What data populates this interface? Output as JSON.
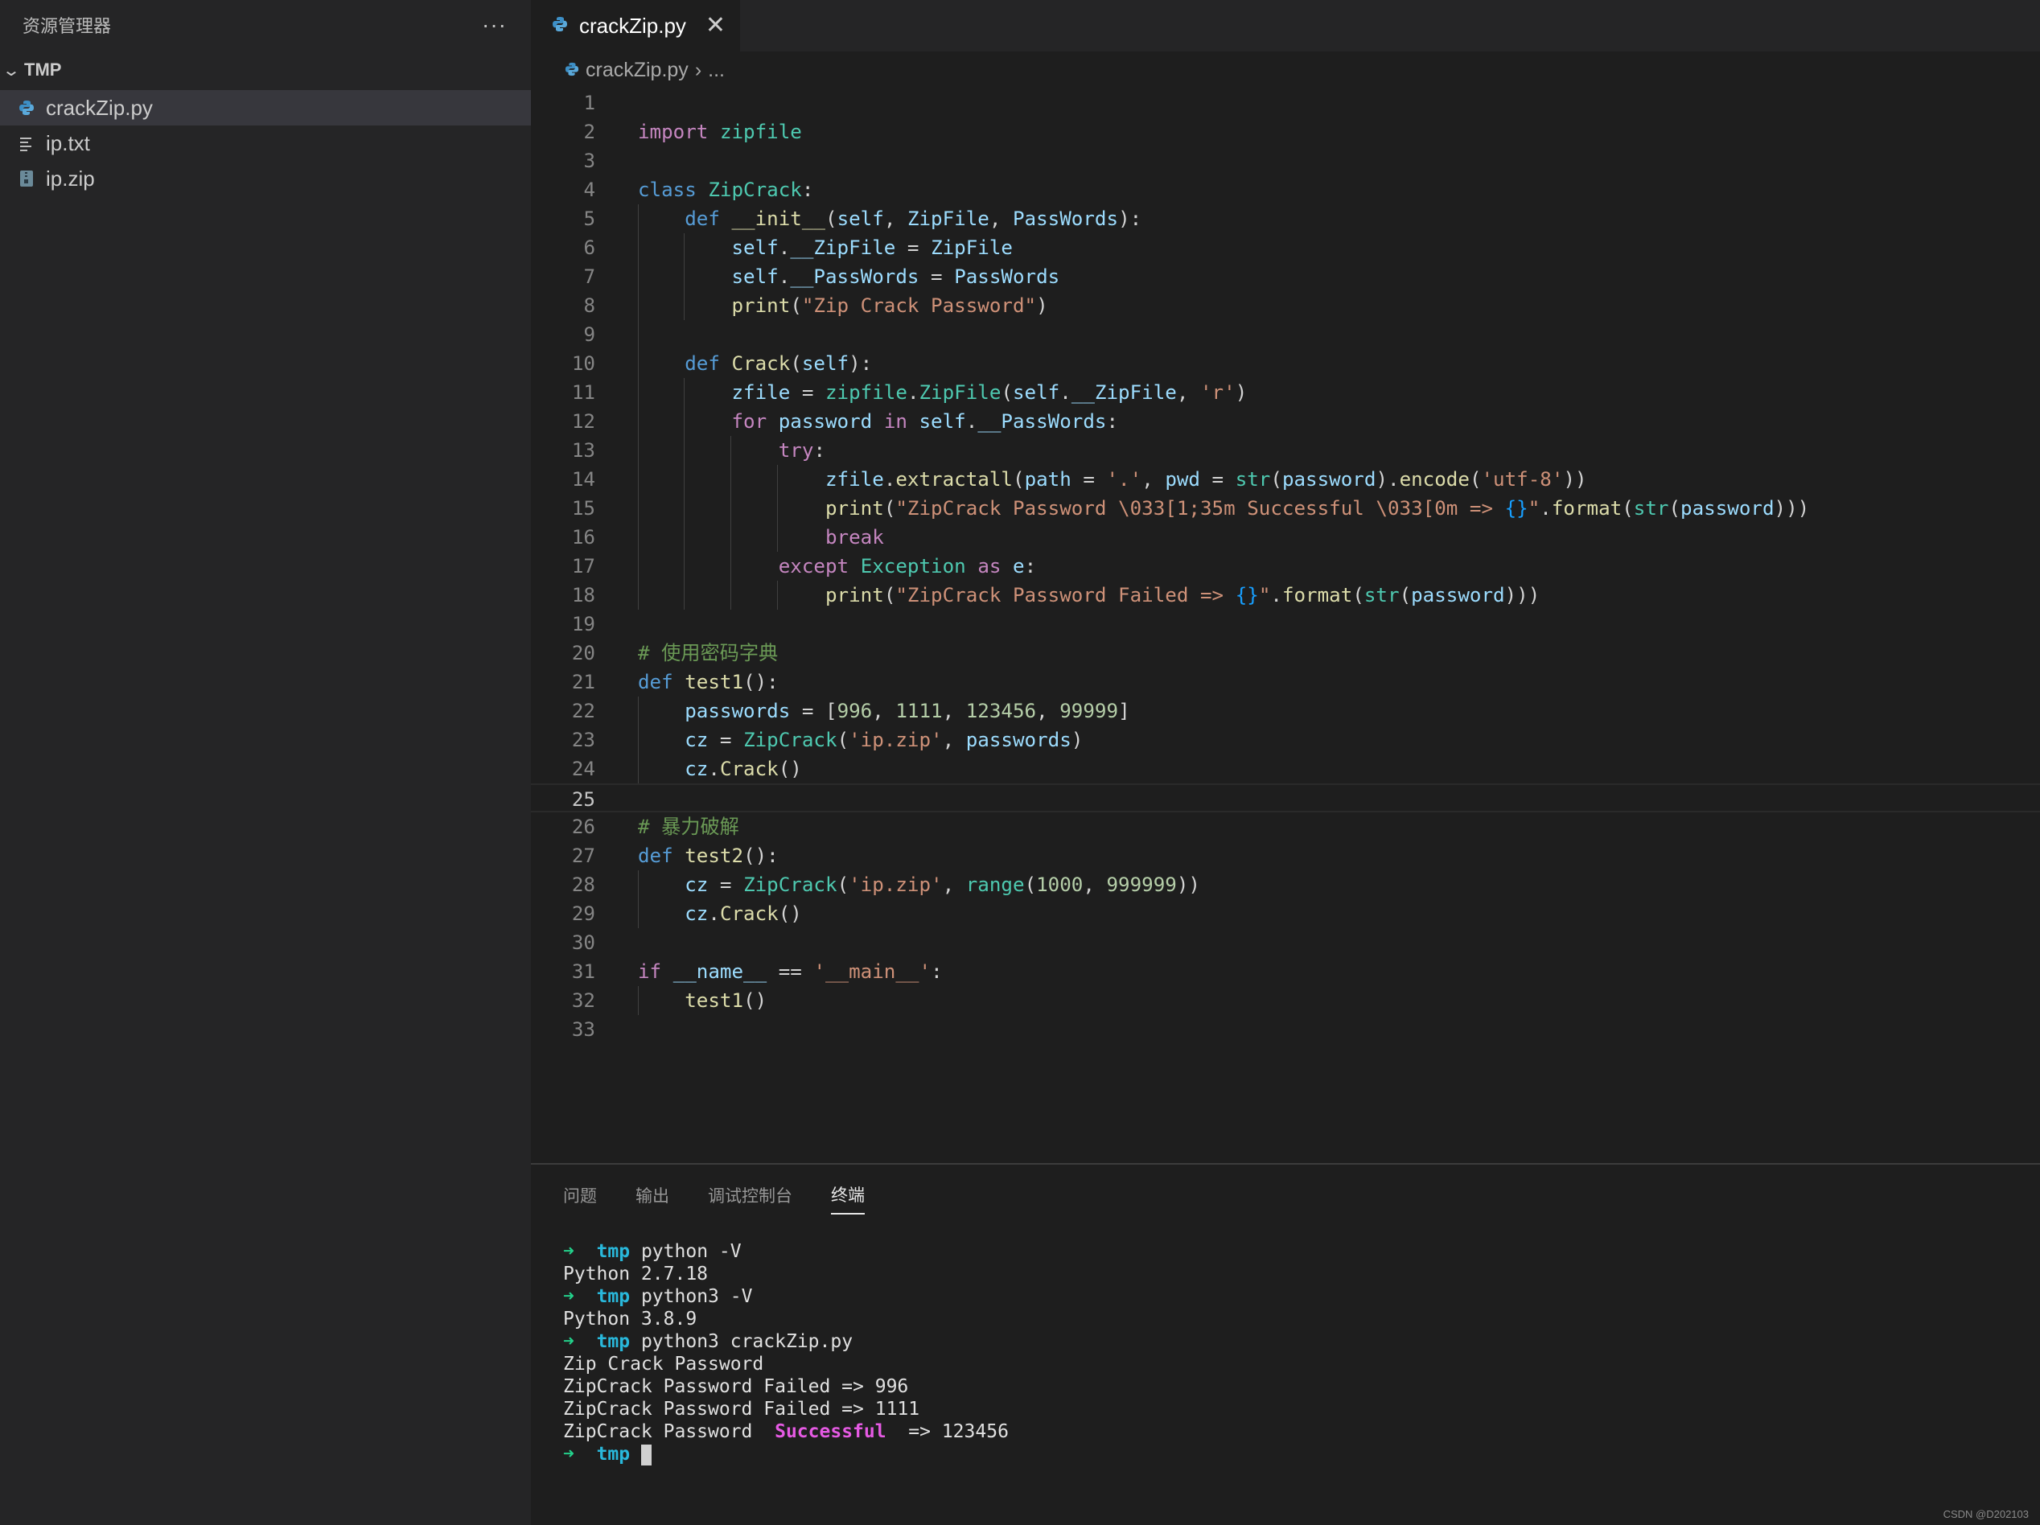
{
  "sidebar": {
    "title": "资源管理器",
    "more": "···",
    "folder": "TMP",
    "files": [
      {
        "label": "crackZip.py",
        "icon": "python-file-icon",
        "active": true
      },
      {
        "label": "ip.txt",
        "icon": "text-file-icon",
        "active": false
      },
      {
        "label": "ip.zip",
        "icon": "zip-file-icon",
        "active": false
      }
    ]
  },
  "editor": {
    "tab_label": "crackZip.py",
    "close_glyph": "✕",
    "breadcrumb_file": "crackZip.py",
    "breadcrumb_sep": "›",
    "breadcrumb_more": "...",
    "current_line": 25,
    "lines": [
      {
        "n": "1",
        "indent": 0,
        "t": []
      },
      {
        "n": "2",
        "indent": 0,
        "t": [
          [
            "import",
            "kw2"
          ],
          [
            " ",
            "pl"
          ],
          [
            "zipfile",
            "cls"
          ]
        ]
      },
      {
        "n": "3",
        "indent": 0,
        "t": []
      },
      {
        "n": "4",
        "indent": 0,
        "t": [
          [
            "class",
            "kw"
          ],
          [
            " ",
            "pl"
          ],
          [
            "ZipCrack",
            "cls"
          ],
          [
            ":",
            "pl"
          ]
        ]
      },
      {
        "n": "5",
        "indent": 1,
        "t": [
          [
            "    ",
            "pl"
          ],
          [
            "def",
            "kw"
          ],
          [
            " ",
            "pl"
          ],
          [
            "__init__",
            "fn"
          ],
          [
            "(",
            "pl"
          ],
          [
            "self",
            "var"
          ],
          [
            ", ",
            "pl"
          ],
          [
            "ZipFile",
            "var"
          ],
          [
            ", ",
            "pl"
          ],
          [
            "PassWords",
            "var"
          ],
          [
            "):",
            "pl"
          ]
        ]
      },
      {
        "n": "6",
        "indent": 2,
        "t": [
          [
            "        ",
            "pl"
          ],
          [
            "self",
            "var"
          ],
          [
            ".",
            "pl"
          ],
          [
            "__ZipFile",
            "var"
          ],
          [
            " = ",
            "pl"
          ],
          [
            "ZipFile",
            "var"
          ]
        ]
      },
      {
        "n": "7",
        "indent": 2,
        "t": [
          [
            "        ",
            "pl"
          ],
          [
            "self",
            "var"
          ],
          [
            ".",
            "pl"
          ],
          [
            "__PassWords",
            "var"
          ],
          [
            " = ",
            "pl"
          ],
          [
            "PassWords",
            "var"
          ]
        ]
      },
      {
        "n": "8",
        "indent": 2,
        "t": [
          [
            "        ",
            "pl"
          ],
          [
            "print",
            "fn"
          ],
          [
            "(",
            "pl"
          ],
          [
            "\"Zip Crack Password\"",
            "str"
          ],
          [
            ")",
            "pl"
          ]
        ]
      },
      {
        "n": "9",
        "indent": 1,
        "t": []
      },
      {
        "n": "10",
        "indent": 1,
        "t": [
          [
            "    ",
            "pl"
          ],
          [
            "def",
            "kw"
          ],
          [
            " ",
            "pl"
          ],
          [
            "Crack",
            "fn"
          ],
          [
            "(",
            "pl"
          ],
          [
            "self",
            "var"
          ],
          [
            "):",
            "pl"
          ]
        ]
      },
      {
        "n": "11",
        "indent": 2,
        "t": [
          [
            "        ",
            "pl"
          ],
          [
            "zfile",
            "var"
          ],
          [
            " = ",
            "pl"
          ],
          [
            "zipfile",
            "cls"
          ],
          [
            ".",
            "pl"
          ],
          [
            "ZipFile",
            "cls"
          ],
          [
            "(",
            "pl"
          ],
          [
            "self",
            "var"
          ],
          [
            ".",
            "pl"
          ],
          [
            "__ZipFile",
            "var"
          ],
          [
            ", ",
            "pl"
          ],
          [
            "'r'",
            "str"
          ],
          [
            ")",
            "pl"
          ]
        ]
      },
      {
        "n": "12",
        "indent": 2,
        "t": [
          [
            "        ",
            "pl"
          ],
          [
            "for",
            "kw2"
          ],
          [
            " ",
            "pl"
          ],
          [
            "password",
            "var"
          ],
          [
            " ",
            "pl"
          ],
          [
            "in",
            "kw2"
          ],
          [
            " ",
            "pl"
          ],
          [
            "self",
            "var"
          ],
          [
            ".",
            "pl"
          ],
          [
            "__PassWords",
            "var"
          ],
          [
            ":",
            "pl"
          ]
        ]
      },
      {
        "n": "13",
        "indent": 3,
        "t": [
          [
            "            ",
            "pl"
          ],
          [
            "try",
            "kw2"
          ],
          [
            ":",
            "pl"
          ]
        ]
      },
      {
        "n": "14",
        "indent": 4,
        "t": [
          [
            "                ",
            "pl"
          ],
          [
            "zfile",
            "var"
          ],
          [
            ".",
            "pl"
          ],
          [
            "extractall",
            "fn"
          ],
          [
            "(",
            "pl"
          ],
          [
            "path",
            "var"
          ],
          [
            " = ",
            "pl"
          ],
          [
            "'.'",
            "str"
          ],
          [
            ", ",
            "pl"
          ],
          [
            "pwd",
            "var"
          ],
          [
            " = ",
            "pl"
          ],
          [
            "str",
            "cls"
          ],
          [
            "(",
            "pl"
          ],
          [
            "password",
            "var"
          ],
          [
            ").",
            "pl"
          ],
          [
            "encode",
            "fn"
          ],
          [
            "(",
            "pl"
          ],
          [
            "'utf-8'",
            "str"
          ],
          [
            "))",
            "pl"
          ]
        ]
      },
      {
        "n": "15",
        "indent": 4,
        "t": [
          [
            "                ",
            "pl"
          ],
          [
            "print",
            "fn"
          ],
          [
            "(",
            "pl"
          ],
          [
            "\"ZipCrack Password \\033[1;35m Successful \\033[0m => ",
            "str"
          ],
          [
            "{}",
            "br"
          ],
          [
            "\"",
            "str"
          ],
          [
            ".",
            "pl"
          ],
          [
            "format",
            "fn"
          ],
          [
            "(",
            "pl"
          ],
          [
            "str",
            "cls"
          ],
          [
            "(",
            "pl"
          ],
          [
            "password",
            "var"
          ],
          [
            "))",
            "pl"
          ],
          [
            ")",
            "pl"
          ]
        ]
      },
      {
        "n": "16",
        "indent": 4,
        "t": [
          [
            "                ",
            "pl"
          ],
          [
            "break",
            "kw2"
          ]
        ]
      },
      {
        "n": "17",
        "indent": 3,
        "t": [
          [
            "            ",
            "pl"
          ],
          [
            "except",
            "kw2"
          ],
          [
            " ",
            "pl"
          ],
          [
            "Exception",
            "cls"
          ],
          [
            " ",
            "pl"
          ],
          [
            "as",
            "kw2"
          ],
          [
            " ",
            "pl"
          ],
          [
            "e",
            "var"
          ],
          [
            ":",
            "pl"
          ]
        ]
      },
      {
        "n": "18",
        "indent": 4,
        "t": [
          [
            "                ",
            "pl"
          ],
          [
            "print",
            "fn"
          ],
          [
            "(",
            "pl"
          ],
          [
            "\"ZipCrack Password Failed => ",
            "str"
          ],
          [
            "{}",
            "br"
          ],
          [
            "\"",
            "str"
          ],
          [
            ".",
            "pl"
          ],
          [
            "format",
            "fn"
          ],
          [
            "(",
            "pl"
          ],
          [
            "str",
            "cls"
          ],
          [
            "(",
            "pl"
          ],
          [
            "password",
            "var"
          ],
          [
            ")))",
            "pl"
          ]
        ]
      },
      {
        "n": "19",
        "indent": 0,
        "t": []
      },
      {
        "n": "20",
        "indent": 0,
        "t": [
          [
            "# 使用密码字典",
            "cm"
          ]
        ]
      },
      {
        "n": "21",
        "indent": 0,
        "t": [
          [
            "def",
            "kw"
          ],
          [
            " ",
            "pl"
          ],
          [
            "test1",
            "fn"
          ],
          [
            "():",
            "pl"
          ]
        ]
      },
      {
        "n": "22",
        "indent": 1,
        "t": [
          [
            "    ",
            "pl"
          ],
          [
            "passwords",
            "var"
          ],
          [
            " = [",
            "pl"
          ],
          [
            "996",
            "num"
          ],
          [
            ", ",
            "pl"
          ],
          [
            "1111",
            "num"
          ],
          [
            ", ",
            "pl"
          ],
          [
            "123456",
            "num"
          ],
          [
            ", ",
            "pl"
          ],
          [
            "99999",
            "num"
          ],
          [
            "]",
            "pl"
          ]
        ]
      },
      {
        "n": "23",
        "indent": 1,
        "t": [
          [
            "    ",
            "pl"
          ],
          [
            "cz",
            "var"
          ],
          [
            " = ",
            "pl"
          ],
          [
            "ZipCrack",
            "cls"
          ],
          [
            "(",
            "pl"
          ],
          [
            "'ip.zip'",
            "str"
          ],
          [
            ", ",
            "pl"
          ],
          [
            "passwords",
            "var"
          ],
          [
            ")",
            "pl"
          ]
        ]
      },
      {
        "n": "24",
        "indent": 1,
        "t": [
          [
            "    ",
            "pl"
          ],
          [
            "cz",
            "var"
          ],
          [
            ".",
            "pl"
          ],
          [
            "Crack",
            "fn"
          ],
          [
            "()",
            "pl"
          ]
        ]
      },
      {
        "n": "25",
        "indent": 0,
        "t": []
      },
      {
        "n": "26",
        "indent": 0,
        "t": [
          [
            "# 暴力破解",
            "cm"
          ]
        ]
      },
      {
        "n": "27",
        "indent": 0,
        "t": [
          [
            "def",
            "kw"
          ],
          [
            " ",
            "pl"
          ],
          [
            "test2",
            "fn"
          ],
          [
            "():",
            "pl"
          ]
        ]
      },
      {
        "n": "28",
        "indent": 1,
        "t": [
          [
            "    ",
            "pl"
          ],
          [
            "cz",
            "var"
          ],
          [
            " = ",
            "pl"
          ],
          [
            "ZipCrack",
            "cls"
          ],
          [
            "(",
            "pl"
          ],
          [
            "'ip.zip'",
            "str"
          ],
          [
            ", ",
            "pl"
          ],
          [
            "range",
            "cls"
          ],
          [
            "(",
            "pl"
          ],
          [
            "1000",
            "num"
          ],
          [
            ", ",
            "pl"
          ],
          [
            "999999",
            "num"
          ],
          [
            "))",
            "pl"
          ]
        ]
      },
      {
        "n": "29",
        "indent": 1,
        "t": [
          [
            "    ",
            "pl"
          ],
          [
            "cz",
            "var"
          ],
          [
            ".",
            "pl"
          ],
          [
            "Crack",
            "fn"
          ],
          [
            "()",
            "pl"
          ]
        ]
      },
      {
        "n": "30",
        "indent": 0,
        "t": []
      },
      {
        "n": "31",
        "indent": 0,
        "t": [
          [
            "if",
            "kw2"
          ],
          [
            " ",
            "pl"
          ],
          [
            "__name__",
            "var"
          ],
          [
            " == ",
            "pl"
          ],
          [
            "'__main__'",
            "str"
          ],
          [
            ":",
            "pl"
          ]
        ]
      },
      {
        "n": "32",
        "indent": 1,
        "t": [
          [
            "    ",
            "pl"
          ],
          [
            "test1",
            "fn"
          ],
          [
            "()",
            "pl"
          ]
        ]
      },
      {
        "n": "33",
        "indent": 0,
        "t": []
      }
    ]
  },
  "panel": {
    "tabs": [
      {
        "label": "问题",
        "active": false
      },
      {
        "label": "输出",
        "active": false
      },
      {
        "label": "调试控制台",
        "active": false
      },
      {
        "label": "终端",
        "active": true
      }
    ],
    "terminal_lines": [
      [
        [
          "➜",
          "arrow"
        ],
        [
          "  ",
          ""
        ],
        [
          "tmp",
          "tdir"
        ],
        [
          " python -V",
          ""
        ]
      ],
      [
        [
          "Python 2.7.18",
          ""
        ]
      ],
      [
        [
          "➜",
          "arrow"
        ],
        [
          "  ",
          ""
        ],
        [
          "tmp",
          "tdir"
        ],
        [
          " python3 -V",
          ""
        ]
      ],
      [
        [
          "Python 3.8.9",
          ""
        ]
      ],
      [
        [
          "➜",
          "arrow"
        ],
        [
          "  ",
          ""
        ],
        [
          "tmp",
          "tdir"
        ],
        [
          " python3 crackZip.py",
          ""
        ]
      ],
      [
        [
          "Zip Crack Password",
          ""
        ]
      ],
      [
        [
          "ZipCrack Password Failed => 996",
          ""
        ]
      ],
      [
        [
          "ZipCrack Password Failed => 1111",
          ""
        ]
      ],
      [
        [
          "ZipCrack Password  ",
          ""
        ],
        [
          "Successful",
          "succ"
        ],
        [
          "  => 123456",
          ""
        ]
      ],
      [
        [
          "➜",
          "arrow"
        ],
        [
          "  ",
          ""
        ],
        [
          "tmp",
          "tdir"
        ],
        [
          " ",
          ""
        ],
        [
          "",
          "cursor"
        ]
      ]
    ]
  },
  "watermark": "CSDN @D202103",
  "colors": {
    "editor_bg": "#1e1e1e",
    "sidebar_bg": "#252526",
    "selection_bg": "#37373d",
    "python_icon": "#3d8fc6",
    "success_magenta": "#e55ae3",
    "prompt_green": "#23d18b",
    "dir_cyan": "#29b8db"
  }
}
